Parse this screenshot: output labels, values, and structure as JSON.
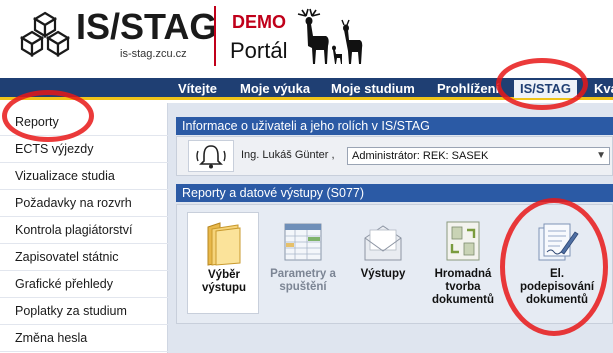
{
  "header": {
    "logo_text": "IS/STAG",
    "logo_url": "is-stag.zcu.cz",
    "demo_label": "DEMO",
    "portal_label": "Portál"
  },
  "nav": {
    "items": [
      {
        "label": "Vítejte"
      },
      {
        "label": "Moje výuka"
      },
      {
        "label": "Moje studium"
      },
      {
        "label": "Prohlížení"
      },
      {
        "label": "IS/STAG",
        "active": true
      },
      {
        "label": "Kva"
      }
    ]
  },
  "sidebar": {
    "items": [
      {
        "label": "Reporty"
      },
      {
        "label": "ECTS výjezdy"
      },
      {
        "label": "Vizualizace studia"
      },
      {
        "label": "Požadavky na rozvrh"
      },
      {
        "label": "Kontrola plagiátorství"
      },
      {
        "label": "Zapisovatel státnic"
      },
      {
        "label": "Grafické přehledy"
      },
      {
        "label": "Poplatky za studium"
      },
      {
        "label": "Změna hesla"
      }
    ]
  },
  "user_panel": {
    "title": "Informace o uživateli a jeho rolích v IS/STAG",
    "user_name": "Ing. Lukáš Günter ,",
    "role_value": "Administrátor: REK: SASEK"
  },
  "reports_panel": {
    "title": "Reporty a datové výstupy (S077)",
    "tiles": [
      {
        "label_1": "Výběr",
        "label_2": "výstupu",
        "label_3": "",
        "icon": "folder-icon"
      },
      {
        "label_1": "Parametry a",
        "label_2": "spuštění",
        "label_3": "",
        "icon": "spreadsheet-icon"
      },
      {
        "label_1": "Výstupy",
        "label_2": "",
        "label_3": "",
        "icon": "envelope-icon"
      },
      {
        "label_1": "Hromadná",
        "label_2": "tvorba",
        "label_3": "dokumentů",
        "icon": "recycle-docs-icon"
      },
      {
        "label_1": "El.",
        "label_2": "podepisování",
        "label_3": "dokumentů",
        "icon": "signing-icon"
      }
    ]
  },
  "colors": {
    "nav_bg": "#1f3f73",
    "nav_accent": "#f0c419",
    "panel_head_bg": "#2b5aa5",
    "demo_red": "#c0001a",
    "highlight_red": "#e81717"
  }
}
